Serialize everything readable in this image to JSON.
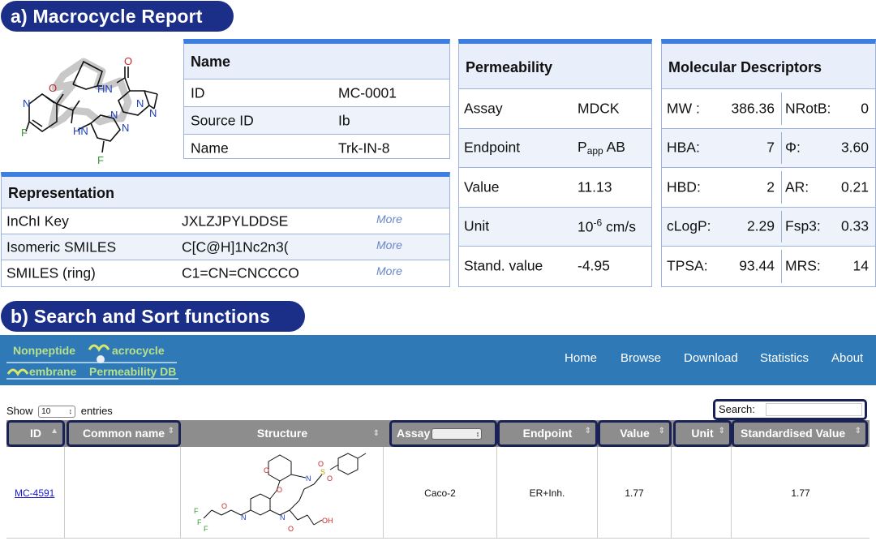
{
  "sections": {
    "a_title": "a) Macrocycle Report",
    "b_title": "b) Search and Sort functions"
  },
  "name_card": {
    "header": "Name",
    "rows": [
      {
        "label": "ID",
        "value": "MC-0001"
      },
      {
        "label": "Source ID",
        "value": "Ib"
      },
      {
        "label": "Name",
        "value": "Trk-IN-8"
      }
    ]
  },
  "representation": {
    "header": "Representation",
    "more_label": "More",
    "rows": [
      {
        "label": "InChI Key",
        "value": "JXLZJPYLDDSE"
      },
      {
        "label": "Isomeric SMILES",
        "value": "C[C@H]1Nc2n3("
      },
      {
        "label": "SMILES (ring)",
        "value": "C1=CN=CNCCCO"
      }
    ]
  },
  "permeability": {
    "header": "Permeability",
    "rows": [
      {
        "label": "Assay",
        "value": "MDCK"
      },
      {
        "label": "Endpoint",
        "value_main": "P",
        "value_sub": "app",
        "value_tail": " AB"
      },
      {
        "label": "Value",
        "value": "11.13"
      },
      {
        "label": "Unit",
        "value_main": "10",
        "value_sup": "-6",
        "value_tail": " cm/s"
      },
      {
        "label": "Stand. value",
        "value": "-4.95"
      }
    ]
  },
  "descriptors": {
    "header": "Molecular Descriptors",
    "rows": [
      {
        "k1": "MW :",
        "v1": "386.36",
        "k2": "NRotB:",
        "v2": "0"
      },
      {
        "k1": "HBA:",
        "v1": "7",
        "k2": "Φ:",
        "v2": "3.60"
      },
      {
        "k1": "HBD:",
        "v1": "2",
        "k2": "AR:",
        "v2": "0.21"
      },
      {
        "k1": "cLogP:",
        "v1": "2.29",
        "k2": "Fsp3:",
        "v2": "0.33"
      },
      {
        "k1": "TPSA:",
        "v1": "93.44",
        "k2": "MRS:",
        "v2": "14"
      }
    ]
  },
  "molecule_labels": {
    "O": "O",
    "N": "N",
    "HN": "HN",
    "NH": "HN",
    "F": "F",
    "OH": "OH",
    "S": "S"
  },
  "navbar": {
    "logo_line1a": "Nonpeptide",
    "logo_line1b": "acrocycle",
    "logo_line2a": "embrane",
    "logo_line2b": "Permeability DB",
    "items": [
      "Home",
      "Browse",
      "Download",
      "Statistics",
      "About"
    ]
  },
  "table_controls": {
    "show_label": "Show",
    "entries_value": "10",
    "entries_label": "entries",
    "search_label": "Search:"
  },
  "table": {
    "columns": [
      "ID",
      "Common name",
      "Structure",
      "Assay",
      "Endpoint",
      "Value",
      "Unit",
      "Standardised Value"
    ],
    "row": {
      "id": "MC-4591",
      "common_name": "",
      "assay": "Caco-2",
      "endpoint": "ER+Inh.",
      "value": "1.77",
      "unit": "",
      "standardised_value": "1.77"
    }
  },
  "colors": {
    "pill": "#1c2f88",
    "card_border_top": "#3d7fe0",
    "navbar": "#2f7ab6",
    "table_header": "#8d8d8d",
    "highlight_box": "#1a2255"
  }
}
